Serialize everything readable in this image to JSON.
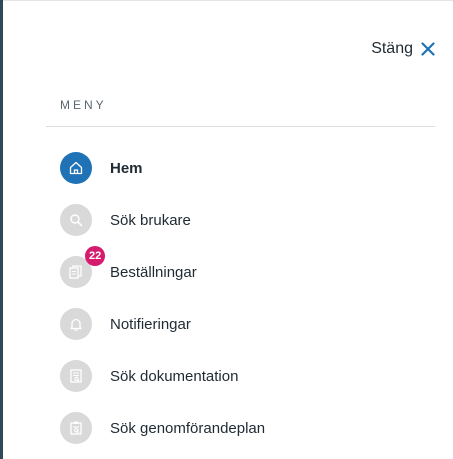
{
  "header": {
    "close_label": "Stäng",
    "close_icon": "close-icon"
  },
  "menu": {
    "title": "MENY",
    "items": [
      {
        "label": "Hem",
        "icon": "home-icon",
        "active": true
      },
      {
        "label": "Sök brukare",
        "icon": "search-icon",
        "active": false
      },
      {
        "label": "Beställningar",
        "icon": "orders-icon",
        "active": false,
        "badge": "22"
      },
      {
        "label": "Notifieringar",
        "icon": "bell-icon",
        "active": false
      },
      {
        "label": "Sök dokumentation",
        "icon": "document-icon",
        "active": false
      },
      {
        "label": "Sök genomförandeplan",
        "icon": "clipboard-icon",
        "active": false
      }
    ]
  },
  "colors": {
    "accent": "#1e72b5",
    "badge": "#d41b6d",
    "inactive_icon_bg": "#d9d9d9"
  }
}
